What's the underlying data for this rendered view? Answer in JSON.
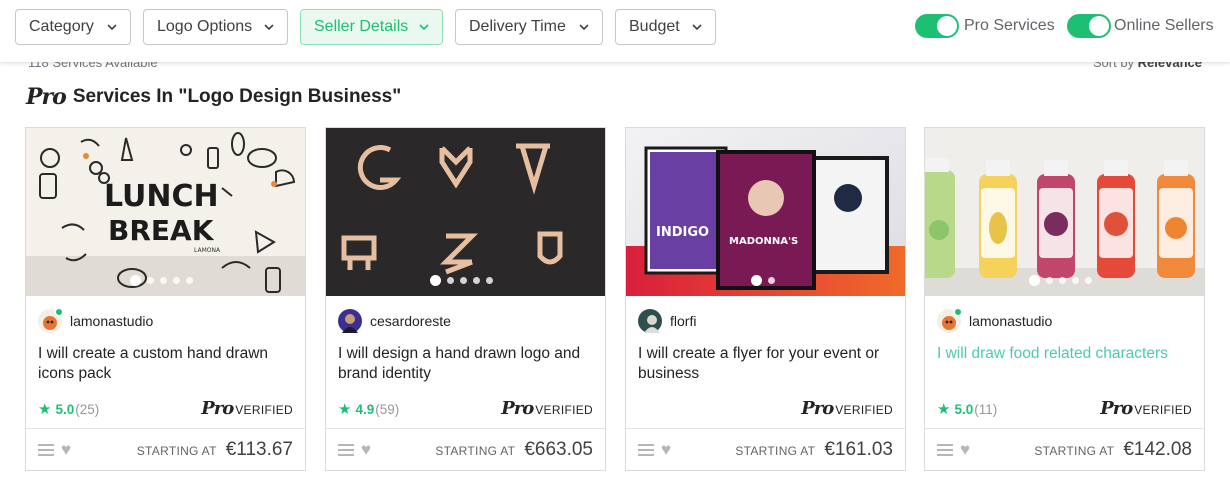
{
  "filters": {
    "category": "Category",
    "logo_options": "Logo Options",
    "seller_details": "Seller Details",
    "delivery_time": "Delivery Time",
    "budget": "Budget"
  },
  "toggles": {
    "pro_services": "Pro Services",
    "online_sellers": "Online Sellers"
  },
  "results": {
    "available": "118 Services Available",
    "sort_label": "Sort by",
    "sort_value": "Relevance"
  },
  "section": {
    "pro_mark": "Pro",
    "title": "Services In \"Logo Design Business\""
  },
  "cards": [
    {
      "seller": "lamonastudio",
      "title": "I will create a custom hand drawn icons pack",
      "rating": "5.0",
      "reviews": "(25)",
      "pro": "Pro",
      "verified": "VERIFIED",
      "starting": "STARTING AT",
      "price": "€113.67",
      "image_text": [
        "LUNCH",
        "BREAK",
        "LAMONA"
      ]
    },
    {
      "seller": "cesardoreste",
      "title": "I will design a hand drawn logo and brand identity",
      "rating": "4.9",
      "reviews": "(59)",
      "pro": "Pro",
      "verified": "VERIFIED",
      "starting": "STARTING AT",
      "price": "€663.05"
    },
    {
      "seller": "florfi",
      "title": "I will create a flyer for your event or business",
      "pro": "Pro",
      "verified": "VERIFIED",
      "starting": "STARTING AT",
      "price": "€161.03",
      "image_text": [
        "INDIGO",
        "MADONNA'S"
      ]
    },
    {
      "seller": "lamonastudio",
      "title": "I will draw food related characters",
      "rating": "5.0",
      "reviews": "(11)",
      "pro": "Pro",
      "verified": "VERIFIED",
      "starting": "STARTING AT",
      "price": "€142.08"
    }
  ],
  "colors": {
    "accent": "#1dbf73",
    "teal_title": "#4ec9b0",
    "active_filter_bg": "#e9f9f0"
  },
  "icons": [
    "chevron-down-icon",
    "star-icon",
    "menu-icon",
    "heart-icon",
    "online-dot-icon"
  ]
}
